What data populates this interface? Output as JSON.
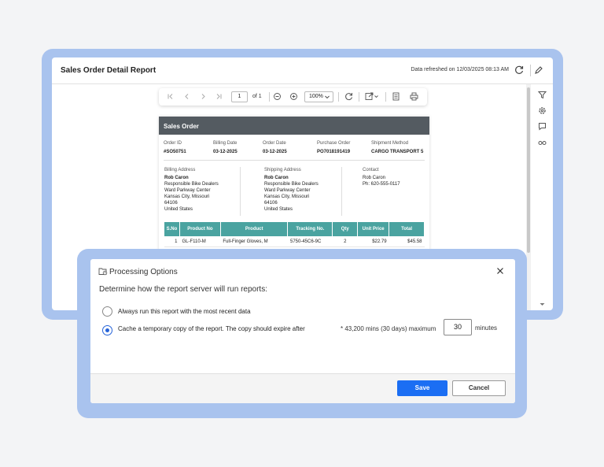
{
  "window": {
    "title": "Sales Order Detail Report",
    "refreshed": "Data refreshed on 12/03/2025 08:13 AM"
  },
  "toolbar": {
    "page_value": "1",
    "page_of": "of 1",
    "zoom": "100%"
  },
  "report": {
    "banner": "Sales Order",
    "meta": [
      {
        "label": "Order ID",
        "value": "#SO50751"
      },
      {
        "label": "Billing Date",
        "value": "03-12-2025"
      },
      {
        "label": "Order Date",
        "value": "03-12-2025"
      },
      {
        "label": "Purchase Order",
        "value": "PO7018191419"
      },
      {
        "label": "Shipment Method",
        "value": "CARGO TRANSPORT 5"
      }
    ],
    "billing": {
      "label": "Billing Address",
      "name": "Rob Caron",
      "lines": [
        "Responsible Bike Dealers",
        "Ward Parkway Center",
        "Kansas City, Missouri",
        "64106",
        "United States"
      ]
    },
    "shipping": {
      "label": "Shipping Address",
      "name": "Rob Caron",
      "lines": [
        "Responsible Bike Dealers",
        "Ward Parkway Center",
        "Kansas City, Missouri",
        "64106",
        "United States"
      ]
    },
    "contact": {
      "label": "Contact",
      "name": "Rob Caron",
      "phone": "Ph: 620-555-0117"
    },
    "table": {
      "headers": [
        "S.No",
        "Product No",
        "Product",
        "Tracking No.",
        "Qty",
        "Unit Price",
        "Total"
      ],
      "rows": [
        [
          "1",
          "GL-F110-M",
          "Full-Finger Gloves, M",
          "5750-45C6-9C",
          "2",
          "$22.79",
          "$45.58"
        ]
      ]
    }
  },
  "dialog": {
    "title": "Processing Options",
    "description": "Determine how the report server will run reports:",
    "option1": "Always run this report with the most recent data",
    "option2": "Cache a temporary copy of the report. The copy should expire after",
    "note": "* 43,200 mins (30 days) maximum",
    "minutes_value": "30",
    "minutes_label": "minutes",
    "save": "Save",
    "cancel": "Cancel"
  }
}
